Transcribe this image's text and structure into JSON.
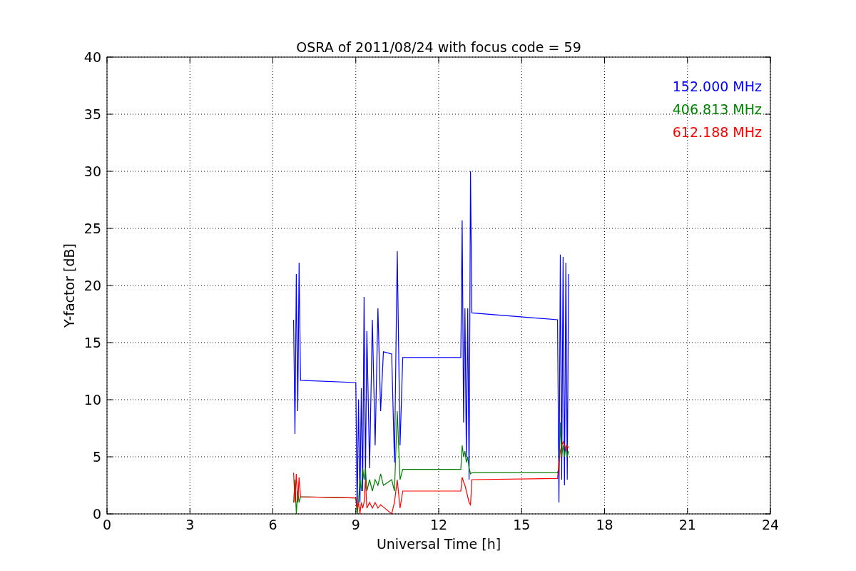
{
  "figure": {
    "chart_data": {
      "type": "line",
      "grid": true,
      "title": "OSRA of 2011/08/24 with focus code = 59",
      "xlabel": "Universal Time [h]",
      "ylabel": "Y-factor [dB]",
      "xlim": [
        0,
        24
      ],
      "ylim": [
        0,
        40
      ],
      "xticks": [
        0,
        3,
        6,
        9,
        12,
        15,
        18,
        21,
        24
      ],
      "yticks": [
        0,
        5,
        10,
        15,
        20,
        25,
        30,
        35,
        40
      ],
      "x": [
        6.75,
        6.8,
        6.85,
        6.9,
        6.95,
        7.0,
        9.0,
        9.05,
        9.1,
        9.15,
        9.2,
        9.25,
        9.3,
        9.35,
        9.4,
        9.5,
        9.6,
        9.7,
        9.8,
        9.9,
        10.0,
        10.3,
        10.4,
        10.5,
        10.6,
        10.7,
        12.8,
        12.85,
        12.9,
        12.95,
        13.0,
        13.05,
        13.1,
        13.15,
        13.2,
        16.3,
        16.35,
        16.4,
        16.45,
        16.5,
        16.55,
        16.6,
        16.65,
        16.7
      ],
      "series": [
        {
          "name": "152.000 MHz",
          "color": "#0000ff",
          "values": [
            17,
            7,
            21,
            9,
            22,
            11.7,
            11.5,
            0,
            10,
            1,
            11,
            2,
            19,
            3,
            16,
            4,
            17,
            6,
            18,
            9,
            14.2,
            14,
            4.5,
            23,
            6,
            13.7,
            13.7,
            25.7,
            8,
            18,
            5,
            18,
            3,
            30,
            17.6,
            17.0,
            1,
            22.7,
            3,
            22.5,
            2.5,
            22,
            3,
            21
          ]
        },
        {
          "name": "406.813 MHz",
          "color": "#008000",
          "values": [
            1,
            3,
            0,
            2,
            1,
            1.5,
            1.4,
            0,
            1,
            3,
            2,
            4,
            3,
            4,
            2,
            3,
            2,
            3,
            2.5,
            3.5,
            2.5,
            3,
            2,
            9,
            3,
            3.9,
            3.9,
            6,
            5,
            5.5,
            4.5,
            5,
            4,
            3.5,
            3.6,
            3.6,
            4,
            8,
            5,
            6,
            5,
            6,
            5,
            5.5
          ]
        },
        {
          "name": "612.188 MHz",
          "color": "#ff0000",
          "values": [
            3.6,
            1,
            3.5,
            1,
            3.2,
            1.5,
            1.4,
            0.5,
            1,
            0,
            1,
            0.5,
            1,
            3,
            0.5,
            1,
            0.5,
            1,
            0.5,
            0.8,
            0.6,
            0,
            1,
            3,
            0.5,
            2.0,
            2.0,
            3.2,
            2.8,
            2.5,
            2,
            1.5,
            1,
            0.8,
            3.0,
            3.1,
            4.5,
            5.5,
            6,
            6.3,
            6,
            5.5,
            6,
            5.8
          ]
        }
      ]
    }
  }
}
